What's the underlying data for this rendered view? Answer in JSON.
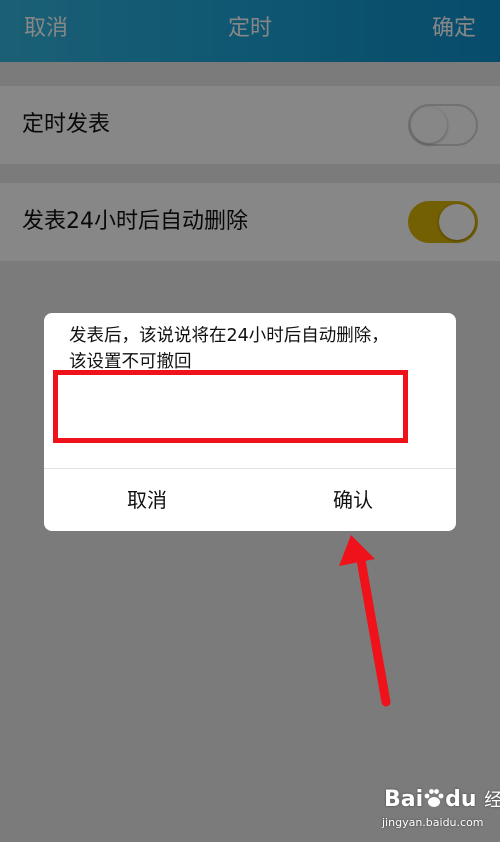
{
  "nav": {
    "cancel": "取消",
    "title": "定时",
    "confirm": "确定"
  },
  "settings": {
    "rows": [
      {
        "label": "定时发表",
        "toggle_on": false
      },
      {
        "label": "发表24小时后自动删除",
        "toggle_on": true
      }
    ]
  },
  "dialog": {
    "message": "发表后，该说说将在24小时后自动删除，该设置不可撤回",
    "cancel": "取消",
    "confirm": "确认"
  },
  "watermark": {
    "brand_bai": "Bai",
    "brand_du": "du",
    "product": "经验",
    "url": "jingyan.baidu.com"
  },
  "colors": {
    "nav_gradient_start": "#33b4dc",
    "nav_gradient_end": "#0f8fc9",
    "toggle_on": "#d9b506",
    "annotation_red": "#f0121a"
  }
}
